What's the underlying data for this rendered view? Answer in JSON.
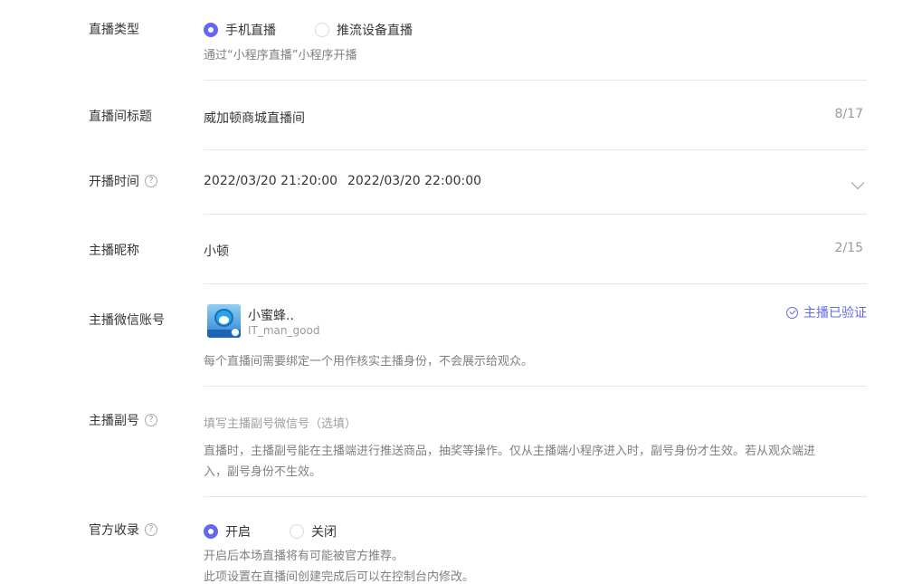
{
  "live_type": {
    "label": "直播类型",
    "options": [
      "手机直播",
      "推流设备直播"
    ],
    "selected": 0,
    "tip": "通过“小程序直播”小程序开播"
  },
  "title": {
    "label": "直播间标题",
    "value": "威加顿商城直播间",
    "counter": "8/17"
  },
  "time": {
    "label": "开播时间",
    "help_icon": "?",
    "start": "2022/03/20 21:20:00",
    "end": "2022/03/20 22:00:00"
  },
  "nickname": {
    "label": "主播昵称",
    "value": "小顿",
    "counter": "2/15"
  },
  "wechat": {
    "label": "主播微信账号",
    "name": "小蜜蜂..",
    "id": "IT_man_good",
    "verified": "主播已验证",
    "tip": "每个直播间需要绑定一个用作核实主播身份，不会展示给观众。"
  },
  "sub_account": {
    "label": "主播副号",
    "help_icon": "?",
    "placeholder": "填写主播副号微信号（选填）",
    "tip_line1": "直播时，主播副号能在主播端进行推送商品，抽奖等操作。仅从主播端小程序进入时，副号身份才生效。若从观众端进",
    "tip_line2": "入，副号身份不生效。"
  },
  "official": {
    "label": "官方收录",
    "help_icon": "?",
    "options": [
      "开启",
      "关闭"
    ],
    "selected": 0,
    "tip_line1": "开启后本场直播将有可能被官方推荐。",
    "tip_line2": "此项设置在直播间创建完成后可以在控制台内修改。"
  },
  "colors": {
    "accent": "#6467f0",
    "text": "#353535",
    "muted": "#9a9a9a",
    "divider": "#e7e7eb"
  }
}
